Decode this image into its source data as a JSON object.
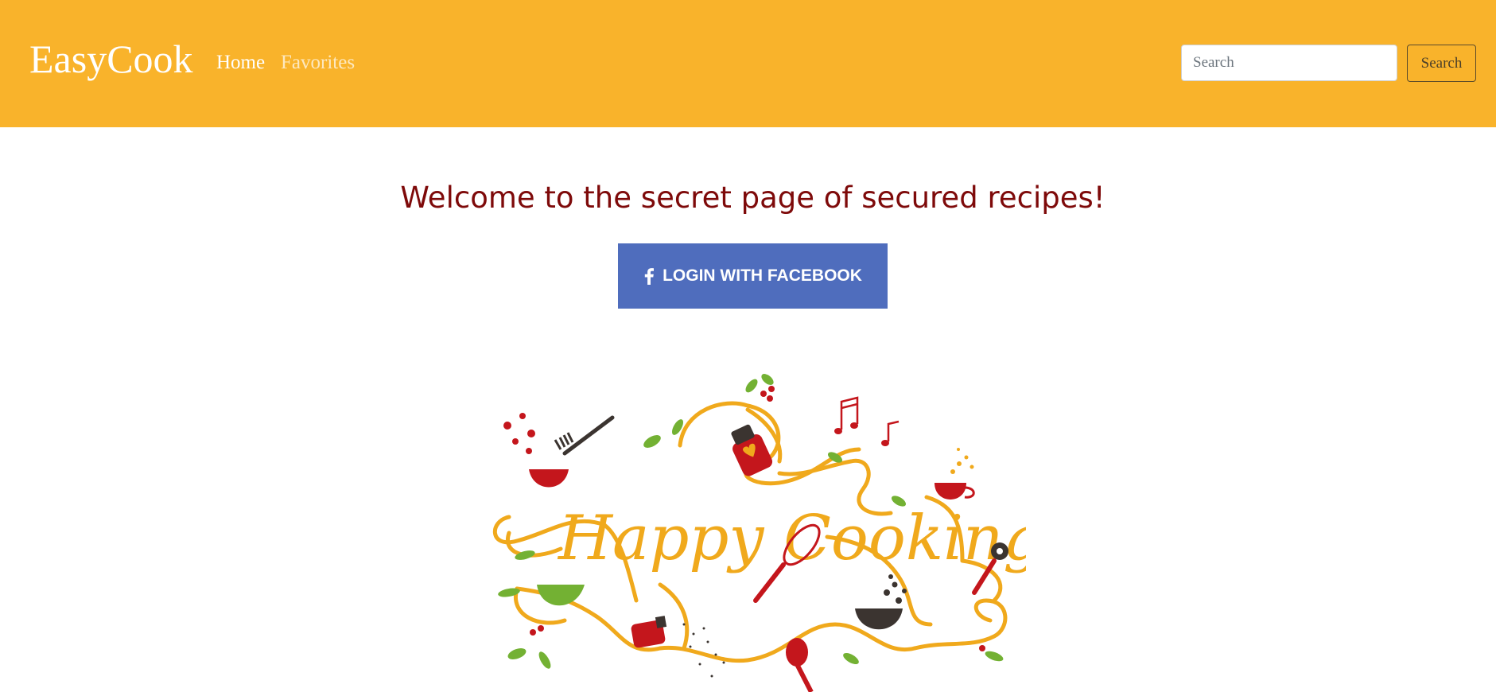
{
  "navbar": {
    "brand": "EasyCook",
    "links": [
      {
        "label": "Home"
      },
      {
        "label": "Favorites"
      }
    ],
    "search": {
      "placeholder": "Search",
      "button_label": "Search"
    },
    "background_color": "#f9b32b"
  },
  "main": {
    "heading": "Welcome to the secret page of secured recipes!",
    "heading_color": "#7e0a0a",
    "login_button": {
      "label": "LOGIN WITH FACEBOOK",
      "icon": "facebook-icon",
      "color": "#4f6dbd"
    },
    "illustration": {
      "lettering": "Happy Cooking"
    }
  }
}
